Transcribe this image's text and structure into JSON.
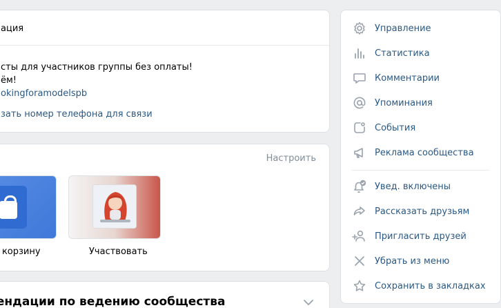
{
  "info": {
    "header": "ация",
    "line1": "сты для участников группы без оплаты!",
    "line2": "ём!",
    "link": "okingforamodelspb",
    "phone_link": "зать номер телефона для связи"
  },
  "actions": {
    "setup_label": "Настроить",
    "tiles": [
      {
        "label": "ти в корзину"
      },
      {
        "label": "Участвовать"
      }
    ]
  },
  "recommendations": {
    "title": "мендации по ведению сообщества"
  },
  "menu": {
    "items": [
      {
        "label": "Управление",
        "icon": "gear-icon"
      },
      {
        "label": "Статистика",
        "icon": "stats-icon"
      },
      {
        "label": "Комментарии",
        "icon": "comment-icon"
      },
      {
        "label": "Упоминания",
        "icon": "at-icon"
      },
      {
        "label": "События",
        "icon": "events-icon"
      },
      {
        "label": "Реклама сообщества",
        "icon": "megaphone-icon"
      },
      {
        "label": "Увед. включены",
        "icon": "bell-check-icon"
      },
      {
        "label": "Рассказать друзьям",
        "icon": "share-icon"
      },
      {
        "label": "Пригласить друзей",
        "icon": "add-user-icon"
      },
      {
        "label": "Убрать из меню",
        "icon": "close-icon"
      },
      {
        "label": "Сохранить в закладках",
        "icon": "star-icon"
      }
    ]
  },
  "colors": {
    "link": "#2a5885",
    "muted": "#818c99",
    "icon": "#99a2ad",
    "background": "#edeef0"
  }
}
